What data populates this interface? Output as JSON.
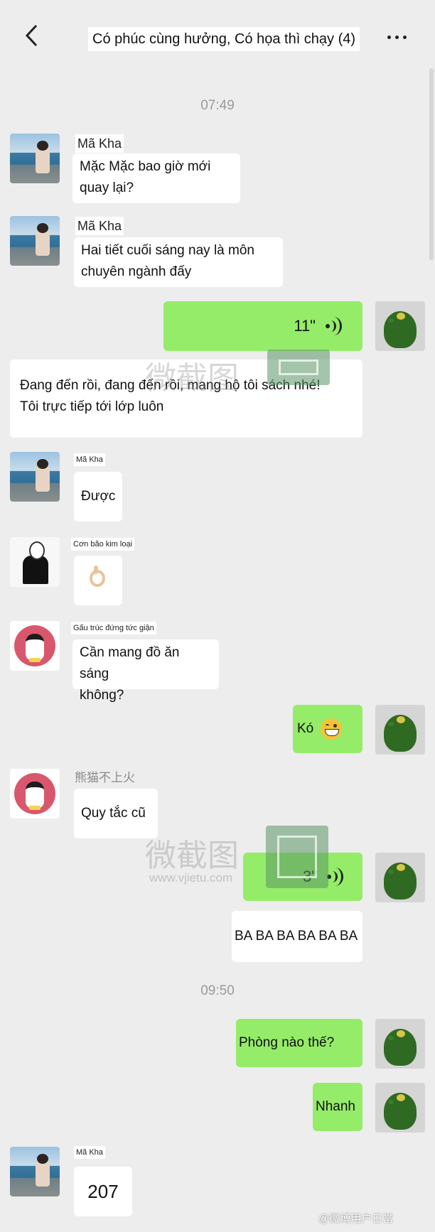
{
  "header": {
    "title": "Có phúc cùng hưởng, Có họa thì chạy (4)",
    "back_icon": "chevron-left-icon",
    "more_icon": "more-dots-icon"
  },
  "colors": {
    "background": "#ededed",
    "outgoing_bubble": "#95ec69",
    "incoming_bubble": "#ffffff"
  },
  "timestamps": [
    "07:49",
    "09:50"
  ],
  "messages": [
    {
      "sender": "Mã Kha",
      "text_lines": [
        "Mặc Mặc bao giờ mới",
        "quay lại?"
      ]
    },
    {
      "sender": "Mã Kha",
      "text_lines": [
        "Hai tiết cuối sáng nay là môn",
        "chuyên ngành đấy"
      ]
    },
    {
      "voice_duration": "11\""
    },
    {
      "text_lines": [
        "Đang đến rồi, đang đến rồi, mang hộ tôi sách nhé!",
        "Tôi trực tiếp tới lớp luôn"
      ]
    },
    {
      "sender": "Mã Kha",
      "text": "Được"
    },
    {
      "sender": "Cơn bão kim loại",
      "emoji": "ok-hand-icon"
    },
    {
      "sender": "Gấu trúc đứng tức giận",
      "text_lines": [
        "Cần mang đồ ăn sáng",
        "không?"
      ]
    },
    {
      "text": "Kó",
      "emoji": "grinning-face-icon"
    },
    {
      "sender": "熊猫不上火",
      "text": "Quy tắc cũ"
    },
    {
      "voice_duration": "3\""
    },
    {
      "text": "BA BA BA BA BA BA"
    },
    {
      "text": "Phòng nào thế?"
    },
    {
      "text": "Nhanh"
    },
    {
      "sender": "Mã Kha",
      "text": "207"
    }
  ],
  "watermark": {
    "text": "微截图",
    "url": "www.vjietu.com"
  },
  "weibo_credit": "@微博用户日常"
}
